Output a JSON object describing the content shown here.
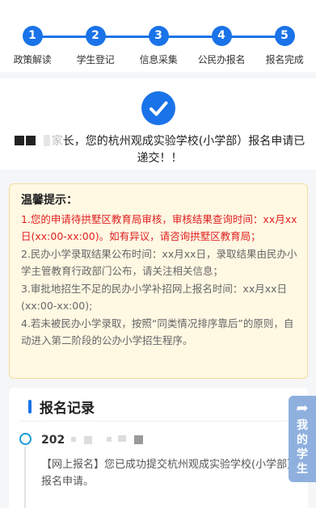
{
  "steps": [
    {
      "num": "1",
      "label": "政策解读"
    },
    {
      "num": "2",
      "label": "学生登记"
    },
    {
      "num": "3",
      "label": "信息采集"
    },
    {
      "num": "4",
      "label": "公民办报名"
    },
    {
      "num": "5",
      "label": "报名完成"
    }
  ],
  "result": {
    "fragment": "家",
    "message": "长，您的杭州观成实验学校(小学部）报名申请已递交！！"
  },
  "tips": {
    "title": "温馨提示：",
    "items": [
      "1.您的申请待拱墅区教育局审核，审核结果查询时间：xx月xx日(xx:00-xx:00)。如有异议，请咨询拱墅区教育局；",
      "2.民办小学录取结果公布时间：xx月xx日，录取结果由民办小学主管教育行政部门公布，请关注相关信息；",
      "3.审批地招生不足的民办小学补招网上报名时间：xx月xx日(xx:00-xx:00);",
      "4.若未被民办小学录取，按照“同类情况排序靠后”的原则，自动进入第二阶段的公办小学招生程序。"
    ]
  },
  "records": {
    "title": "报名记录",
    "entries": [
      {
        "time_prefix": "202",
        "text": "【网上报名】您已成功提交杭州观成实验学校(小学部）报名申请。"
      }
    ]
  },
  "float_tab": {
    "icon": "share-icon",
    "label": "我的学生"
  },
  "colors": {
    "primary": "#1a73e8",
    "tip_red": "#e02020",
    "tip_bg": "#fff8e3",
    "float_tab_bg": "#8fb0de"
  }
}
